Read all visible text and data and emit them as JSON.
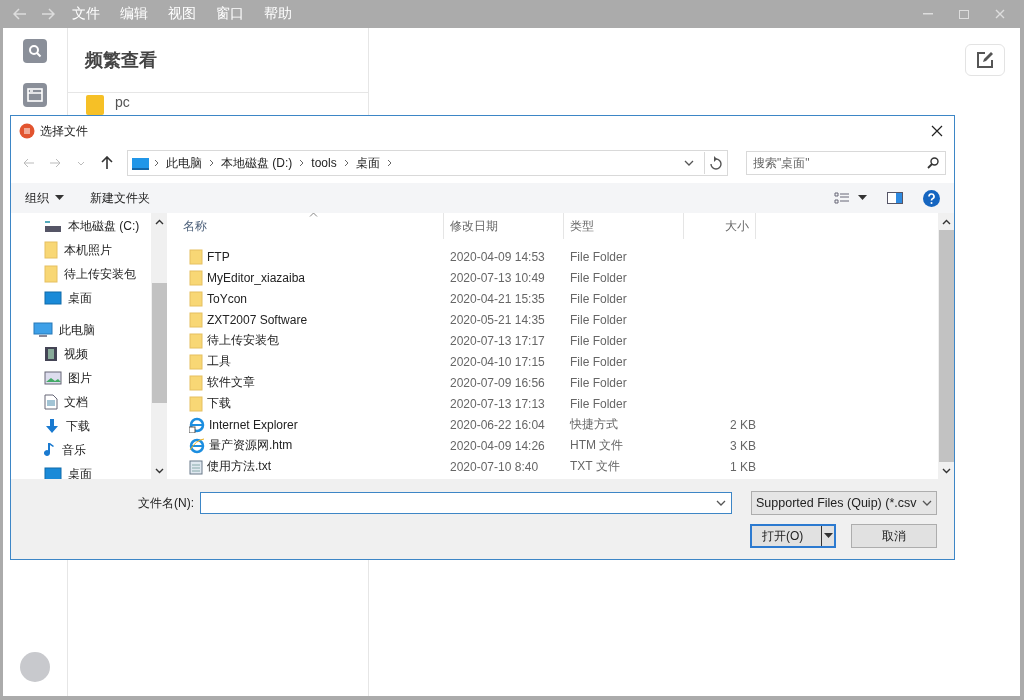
{
  "app": {
    "menu": [
      "文件",
      "编辑",
      "视图",
      "窗口",
      "帮助"
    ],
    "heading": "频繁查看",
    "items": [
      {
        "name": "pc"
      }
    ]
  },
  "dialog": {
    "title": "选择文件",
    "breadcrumb": [
      "此电脑",
      "本地磁盘 (D:)",
      "tools",
      "桌面"
    ],
    "search": {
      "placeholder": "搜索\"桌面\""
    },
    "toolbar": [
      "组织",
      "新建文件夹"
    ],
    "nav": [
      {
        "children": [
          {
            "label": "本地磁盘 (C:)",
            "kind": "drive"
          },
          {
            "label": "本机照片",
            "kind": "folder"
          },
          {
            "label": "待上传安装包",
            "kind": "folder"
          },
          {
            "label": "桌面",
            "kind": "desktop"
          }
        ]
      },
      {
        "label": "此电脑",
        "kind": "pc",
        "children": [
          {
            "label": "视频",
            "kind": "video"
          },
          {
            "label": "图片",
            "kind": "picture"
          },
          {
            "label": "文档",
            "kind": "doc"
          },
          {
            "label": "下载",
            "kind": "download"
          },
          {
            "label": "音乐",
            "kind": "music"
          },
          {
            "label": "桌面",
            "kind": "desktop"
          }
        ]
      }
    ],
    "columns": [
      "名称",
      "修改日期",
      "类型",
      "大小"
    ],
    "rows": [
      {
        "kind": "folder",
        "name": "FTP",
        "date": "2020-04-09 14:53",
        "type": "File Folder"
      },
      {
        "kind": "folder",
        "name": "MyEditor_xiazaiba",
        "date": "2020-07-13 10:49",
        "type": "File Folder"
      },
      {
        "kind": "folder",
        "name": "ToYcon",
        "date": "2020-04-21 15:35",
        "type": "File Folder"
      },
      {
        "kind": "folder",
        "name": "ZXT2007 Software",
        "date": "2020-05-21 14:35",
        "type": "File Folder"
      },
      {
        "kind": "folder",
        "name": "待上传安装包",
        "date": "2020-07-13 17:17",
        "type": "File Folder"
      },
      {
        "kind": "folder",
        "name": "工具",
        "date": "2020-04-10 17:15",
        "type": "File Folder"
      },
      {
        "kind": "folder",
        "name": "软件文章",
        "date": "2020-07-09 16:56",
        "type": "File Folder"
      },
      {
        "kind": "folder",
        "name": "下载",
        "date": "2020-07-13 17:13",
        "type": "File Folder"
      },
      {
        "kind": "shortcut",
        "name": "Internet  Explorer",
        "date": "2020-06-22 16:04",
        "type": "快捷方式",
        "size": "2 KB"
      },
      {
        "kind": "web",
        "name": "量产资源网.htm",
        "date": "2020-04-09 14:26",
        "type": "HTM 文件",
        "size": "3 KB"
      },
      {
        "kind": "text",
        "name": "使用方法.txt",
        "date": "2020-07-10 8:40",
        "type": "TXT 文件",
        "size": "1 KB"
      }
    ],
    "filename": {
      "label": "文件名(N):"
    },
    "filter": "Supported Files (Quip) (*.csv",
    "buttons": [
      {
        "label": "打开(O)",
        "kind": "split"
      },
      {
        "label": "取消",
        "kind": "plain"
      }
    ]
  }
}
